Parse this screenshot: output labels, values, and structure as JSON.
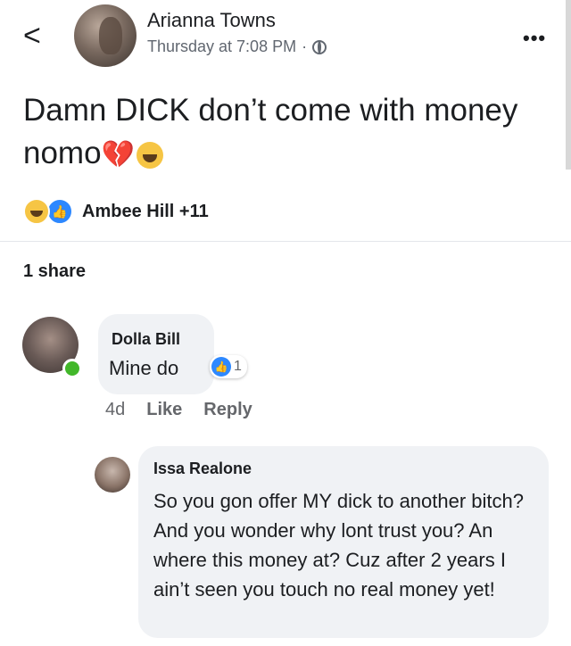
{
  "post": {
    "author": "Arianna Towns",
    "timestamp": "Thursday at 7:08 PM",
    "separator": "·",
    "back_glyph": "<",
    "more_glyph": "•••",
    "text": "Damn DICK don’t come with money nomo",
    "reactions_summary": "Ambee Hill +11",
    "shares": "1 share"
  },
  "comment": {
    "author": "Dolla Bill",
    "text": "Mine do",
    "reaction_count": "1",
    "time": "4d",
    "like_label": "Like",
    "reply_label": "Reply"
  },
  "reply": {
    "author": "Issa Realone",
    "text": "So you gon offer MY dick to another bitch? And you wonder why lont trust you? An where this money at? Cuz after 2 years I ain’t seen you touch no real money yet!"
  },
  "colors": {
    "like_blue": "#2d88ff",
    "online_green": "#42b72a",
    "bubble_bg": "#f0f2f5"
  }
}
